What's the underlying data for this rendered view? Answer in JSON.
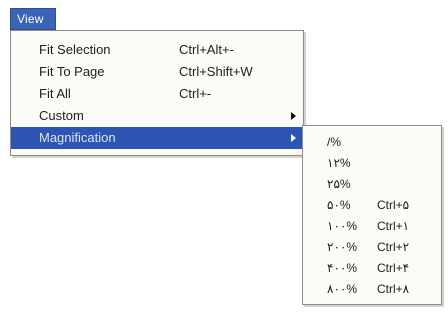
{
  "menubar": {
    "view_label": "View"
  },
  "view_menu": {
    "items": [
      {
        "label": "Fit Selection",
        "shortcut": "Ctrl+Alt+-"
      },
      {
        "label": "Fit To Page",
        "shortcut": "Ctrl+Shift+W"
      },
      {
        "label": "Fit All",
        "shortcut": "Ctrl+-"
      },
      {
        "label": "Custom",
        "shortcut": ""
      },
      {
        "label": "Magnification",
        "shortcut": ""
      }
    ],
    "custom_arrow_icon": "submenu-arrow-icon",
    "magnification_arrow_icon": "submenu-arrow-icon"
  },
  "magnification_menu": {
    "items": [
      {
        "label": "/%",
        "shortcut": ""
      },
      {
        "label": "۱۲%",
        "shortcut": ""
      },
      {
        "label": "۲۵%",
        "shortcut": ""
      },
      {
        "label": "۵۰%",
        "shortcut": "Ctrl+۵"
      },
      {
        "label": "۱۰۰%",
        "shortcut": "Ctrl+۱"
      },
      {
        "label": "۲۰۰%",
        "shortcut": "Ctrl+۲"
      },
      {
        "label": "۴۰۰%",
        "shortcut": "Ctrl+۴"
      },
      {
        "label": "۸۰۰%",
        "shortcut": "Ctrl+۸"
      }
    ]
  },
  "colors": {
    "highlight": "#2d56b4",
    "menu_background": "#fbfbf7",
    "menu_border": "#8d8d88"
  }
}
